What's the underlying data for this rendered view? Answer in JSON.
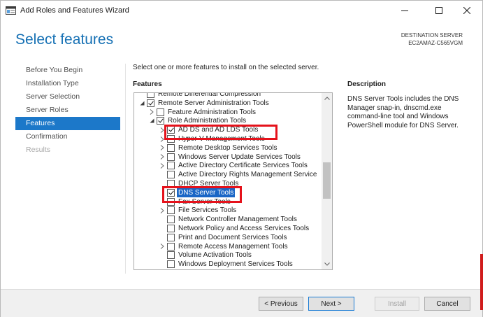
{
  "window": {
    "title": "Add Roles and Features Wizard"
  },
  "header": {
    "page_title": "Select features",
    "destination_label": "DESTINATION SERVER",
    "destination_server": "EC2AMAZ-C565VGM"
  },
  "nav": {
    "items": [
      {
        "label": "Before You Begin",
        "state": "normal"
      },
      {
        "label": "Installation Type",
        "state": "normal"
      },
      {
        "label": "Server Selection",
        "state": "normal"
      },
      {
        "label": "Server Roles",
        "state": "normal"
      },
      {
        "label": "Features",
        "state": "active"
      },
      {
        "label": "Confirmation",
        "state": "normal"
      },
      {
        "label": "Results",
        "state": "disabled"
      }
    ]
  },
  "main": {
    "instruction": "Select one or more features to install on the selected server.",
    "features_header": "Features",
    "description_header": "Description",
    "description_text": "DNS Server Tools includes the DNS Manager snap-in, dnscmd.exe command-line tool and Windows PowerShell module for DNS Server."
  },
  "tree": {
    "rows": [
      {
        "label": "Remote Differential Compression",
        "indent": 1,
        "expander": "none",
        "checked": false,
        "partial_top": true
      },
      {
        "label": "Remote Server Administration Tools",
        "indent": 1,
        "expander": "expanded",
        "checked": true
      },
      {
        "label": "Feature Administration Tools",
        "indent": 2,
        "expander": "collapsed",
        "checked": false
      },
      {
        "label": "Role Administration Tools",
        "indent": 2,
        "expander": "expanded",
        "checked": true
      },
      {
        "label": "AD DS and AD LDS Tools",
        "indent": 3,
        "expander": "collapsed",
        "checked": true
      },
      {
        "label": "Hyper-V Management Tools",
        "indent": 3,
        "expander": "collapsed",
        "checked": false
      },
      {
        "label": "Remote Desktop Services Tools",
        "indent": 3,
        "expander": "collapsed",
        "checked": false
      },
      {
        "label": "Windows Server Update Services Tools",
        "indent": 3,
        "expander": "collapsed",
        "checked": false
      },
      {
        "label": "Active Directory Certificate Services Tools",
        "indent": 3,
        "expander": "collapsed",
        "checked": false
      },
      {
        "label": "Active Directory Rights Management Service",
        "indent": 3,
        "expander": "none",
        "checked": false
      },
      {
        "label": "DHCP Server Tools",
        "indent": 3,
        "expander": "none",
        "checked": false
      },
      {
        "label": "DNS Server Tools",
        "indent": 3,
        "expander": "none",
        "checked": true,
        "selected": true
      },
      {
        "label": "Fax Server Tools",
        "indent": 3,
        "expander": "none",
        "checked": false
      },
      {
        "label": "File Services Tools",
        "indent": 3,
        "expander": "collapsed",
        "checked": false
      },
      {
        "label": "Network Controller Management Tools",
        "indent": 3,
        "expander": "none",
        "checked": false
      },
      {
        "label": "Network Policy and Access Services Tools",
        "indent": 3,
        "expander": "none",
        "checked": false
      },
      {
        "label": "Print and Document Services Tools",
        "indent": 3,
        "expander": "none",
        "checked": false
      },
      {
        "label": "Remote Access Management Tools",
        "indent": 3,
        "expander": "collapsed",
        "checked": false
      },
      {
        "label": "Volume Activation Tools",
        "indent": 3,
        "expander": "none",
        "checked": false
      },
      {
        "label": "Windows Deployment Services Tools",
        "indent": 3,
        "expander": "none",
        "checked": false,
        "partial_bottom": true
      }
    ]
  },
  "footer": {
    "previous_label": "< Previous",
    "next_label": "Next >",
    "install_label": "Install",
    "cancel_label": "Cancel"
  },
  "colors": {
    "accent": "#1c78c9",
    "title_blue": "#1570b4",
    "highlight_red": "#e5121b",
    "selection_blue": "#1a66c6"
  },
  "icons": {
    "app": "server-manager-icon",
    "minimize": "minimize-icon",
    "maximize": "maximize-icon",
    "close": "close-icon",
    "expander_collapsed": "chevron-right-icon",
    "expander_expanded": "chevron-down-icon"
  }
}
